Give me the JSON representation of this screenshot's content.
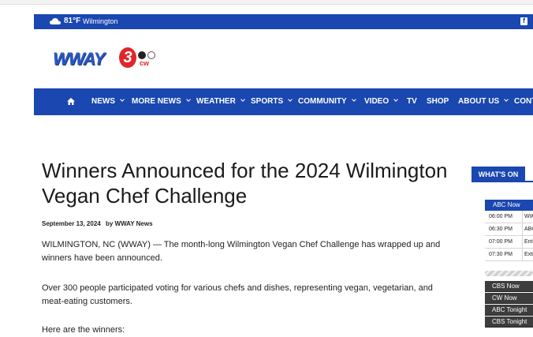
{
  "topbar": {
    "temperature": "81°F",
    "city": "Wilmington"
  },
  "logo": {
    "text": "WWAY",
    "number": "3",
    "cw": "cw"
  },
  "nav": {
    "items": [
      {
        "label": "NEWS",
        "dropdown": true
      },
      {
        "label": "MORE NEWS",
        "dropdown": true
      },
      {
        "label": "WEATHER",
        "dropdown": true
      },
      {
        "label": "SPORTS",
        "dropdown": true
      },
      {
        "label": "COMMUNITY",
        "dropdown": true
      },
      {
        "label": "VIDEO",
        "dropdown": true
      },
      {
        "label": "TV",
        "dropdown": false
      },
      {
        "label": "SHOP",
        "dropdown": false
      },
      {
        "label": "ABOUT US",
        "dropdown": true
      },
      {
        "label": "CONT",
        "dropdown": false
      }
    ]
  },
  "article": {
    "title": "Winners Announced for the 2024 Wilmington Vegan Chef Challenge",
    "date": "September 13, 2024",
    "author": "by WWAY News",
    "paragraphs": [
      "WILMINGTON, NC (WWAY) — The month-long Wilmington Vegan Chef Challenge has wrapped up and winners have been announced.",
      "Over 300 people participated voting for various chefs and dishes, representing vegan, vegetarian, and meat-eating customers.",
      "Here are the winners:"
    ]
  },
  "sidebar": {
    "whats_on": "WHAT'S ON",
    "schedule_header": "ABC Now",
    "schedule": [
      {
        "time": "06:00 PM",
        "show": "WW"
      },
      {
        "time": "06:30 PM",
        "show": "ABC"
      },
      {
        "time": "07:00 PM",
        "show": "Ente"
      },
      {
        "time": "07:30 PM",
        "show": "Extr"
      }
    ],
    "networks": [
      "CBS Now",
      "CW Now",
      "ABC Tonight",
      "CBS Tonight"
    ]
  },
  "colors": {
    "brand_blue": "#1a47b0",
    "logo_red": "#e0262b",
    "dark_tab": "#3d3d3d"
  }
}
